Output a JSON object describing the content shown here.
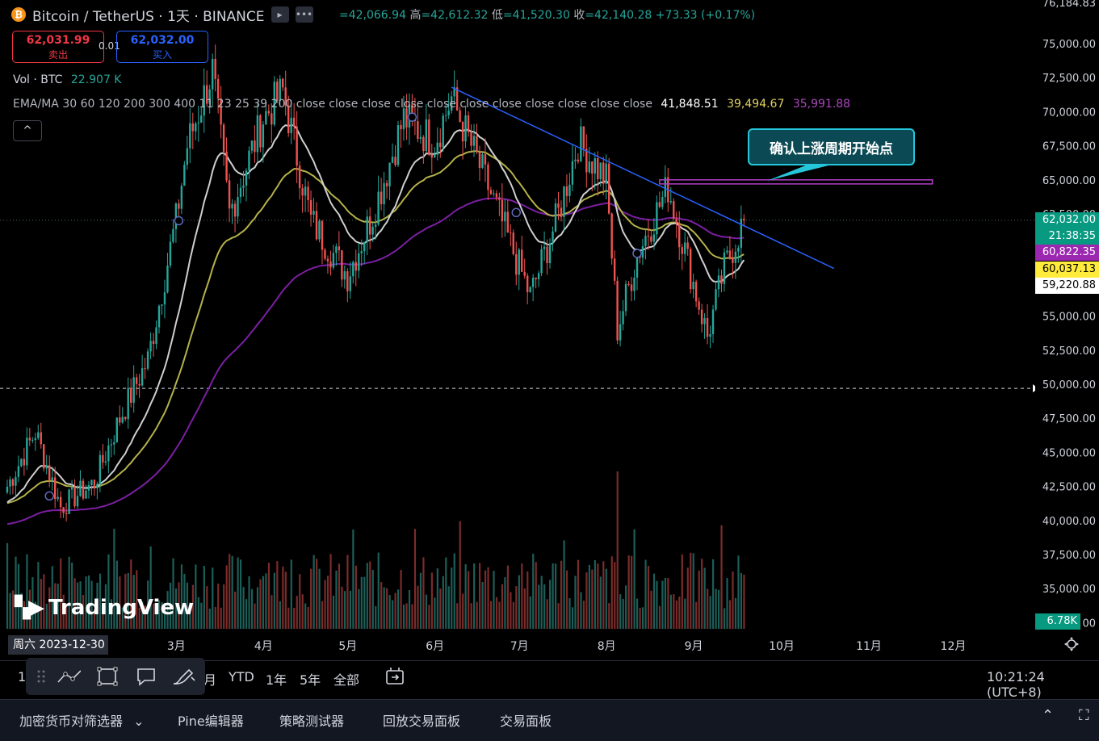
{
  "symbol": {
    "icon": "bitcoin-icon",
    "title": "Bitcoin / TetherUS · 1天 · BINANCE",
    "collapse_glyph": "▸",
    "more_glyph": "•••"
  },
  "ohlc": {
    "open_value": "=42,066.94",
    "high_label": "高",
    "high_value": "=42,612.32",
    "low_label": "低",
    "low_value": "=41,520.30",
    "close_label": "收",
    "close_value": "=42,140.28",
    "change": "+73.33 (+0.17%)"
  },
  "trade": {
    "sell_price": "62,031.99",
    "sell_label": "卖出",
    "spread": "0.01",
    "buy_price": "62,032.00",
    "buy_label": "买入"
  },
  "volume_legend": {
    "label": "Vol · BTC",
    "value": "22.907 K"
  },
  "ema_legend": {
    "label": "EMA/MA 30 60 120 200 300 400 11 23 25 39 200 close close close close close close close close close close close",
    "value1": "41,848.51",
    "value2": "39,494.67",
    "value3": "35,991.88"
  },
  "collapse_button": "^",
  "y_axis": {
    "top_label": "76,184.83",
    "ticks": [
      "75,000.00",
      "72,500.00",
      "70,000.00",
      "67,500.00",
      "65,000.00",
      "62,500.00",
      "57,500.00",
      "55,000.00",
      "52,500.00",
      "50,000.00",
      "47,500.00",
      "45,000.00",
      "42,500.00",
      "40,000.00",
      "37,500.00",
      "35,000.00",
      "00"
    ],
    "price_tags": [
      {
        "text": "62,032.00",
        "bg": "#089981",
        "fg": "#ffffff"
      },
      {
        "text": "21:38:35",
        "bg": "#089981",
        "fg": "#ffffff"
      },
      {
        "text": "60,822.35",
        "bg": "#9c27b0",
        "fg": "#ffffff"
      },
      {
        "text": "60,037.13",
        "bg": "#ffeb3b",
        "fg": "#000000"
      },
      {
        "text": "59,220.88",
        "bg": "#ffffff",
        "fg": "#000000"
      }
    ],
    "volume_tag": {
      "text": "6.78K",
      "bg": "#089981",
      "fg": "#ffffff"
    }
  },
  "x_axis": {
    "cursor_date": "周六 2023-12-30",
    "months": [
      "3月",
      "4月",
      "5月",
      "6月",
      "7月",
      "8月",
      "9月",
      "10月",
      "11月",
      "12月"
    ]
  },
  "annotation": {
    "callout_text": "确认上涨周期开始点"
  },
  "watermark": {
    "text": "TradingView"
  },
  "colors": {
    "up": "#26a69a",
    "down": "#ef5350",
    "trendline": "#2962ff",
    "rectangle": "#9c27b0",
    "ema_white": "#cfcfcf",
    "ema_yellow": "#b5b24a",
    "ema_purple": "#7b1fa2"
  },
  "toolbar": {
    "periods": [
      "1",
      "月",
      "YTD",
      "1年",
      "5年",
      "全部"
    ],
    "draw_icons": [
      "drag-handle-icon",
      "trendline-icon",
      "rectangle-icon",
      "comment-icon",
      "brush-icon"
    ],
    "replay_icon": "replay-icon",
    "time": "10:21:24 (UTC+8)"
  },
  "bottom_panel": {
    "items": [
      "加密货币对筛选器",
      "Pine编辑器",
      "策略测试器",
      "回放交易面板",
      "交易面板"
    ],
    "dropdown_glyph": "⌄",
    "collapse_glyph": "⌃",
    "maximize_glyph": "⛶"
  },
  "chart_data": {
    "type": "line",
    "title": "Bitcoin / TetherUS · 1天 · BINANCE",
    "xlabel": "",
    "ylabel": "",
    "ylim": [
      32500,
      76184.83
    ],
    "x_range": [
      "2023-12-30",
      "2024-12-31"
    ],
    "grid": false,
    "price_series": {
      "name": "",
      "dates": [
        "2024-01-01",
        "2024-01-11",
        "2024-01-20",
        "2024-02-01",
        "2024-02-10",
        "2024-02-20",
        "2024-03-01",
        "2024-03-05",
        "2024-03-14",
        "2024-03-20",
        "2024-04-01",
        "2024-04-08",
        "2024-04-18",
        "2024-05-01",
        "2024-05-10",
        "2024-05-21",
        "2024-06-01",
        "2024-06-07",
        "2024-06-20",
        "2024-07-05",
        "2024-07-15",
        "2024-07-22",
        "2024-08-01",
        "2024-08-05",
        "2024-08-12",
        "2024-08-23",
        "2024-09-06",
        "2024-09-12",
        "2024-09-19"
      ],
      "close": [
        42500,
        46500,
        41000,
        42800,
        47500,
        51800,
        62000,
        67500,
        73000,
        62500,
        69500,
        71500,
        62000,
        58000,
        62500,
        69500,
        67800,
        71000,
        64500,
        56500,
        62500,
        67800,
        65000,
        54000,
        59500,
        64500,
        53500,
        58500,
        62032
      ]
    },
    "volume": {
      "last": 6780
    },
    "indicators": [
      {
        "name": "",
        "value": 41848.51,
        "color": "#cfcfcf",
        "last": 59220.88
      },
      {
        "name": "",
        "value": 39494.67,
        "color": "#b5b24a",
        "last": 60037.13
      },
      {
        "name": "",
        "value": 35991.88,
        "color": "#7b1fa2",
        "last": 60822.35
      }
    ],
    "trendline": {
      "from": {
        "date": "2024-06-07",
        "price": 71800
      },
      "to": {
        "date": "2024-10-21",
        "price": 58500
      }
    },
    "horizontal_line": 49700,
    "rectangle": {
      "from_date": "2024-08-20",
      "to_date": "2024-11-25",
      "top": 65000,
      "bottom": 64700
    }
  }
}
